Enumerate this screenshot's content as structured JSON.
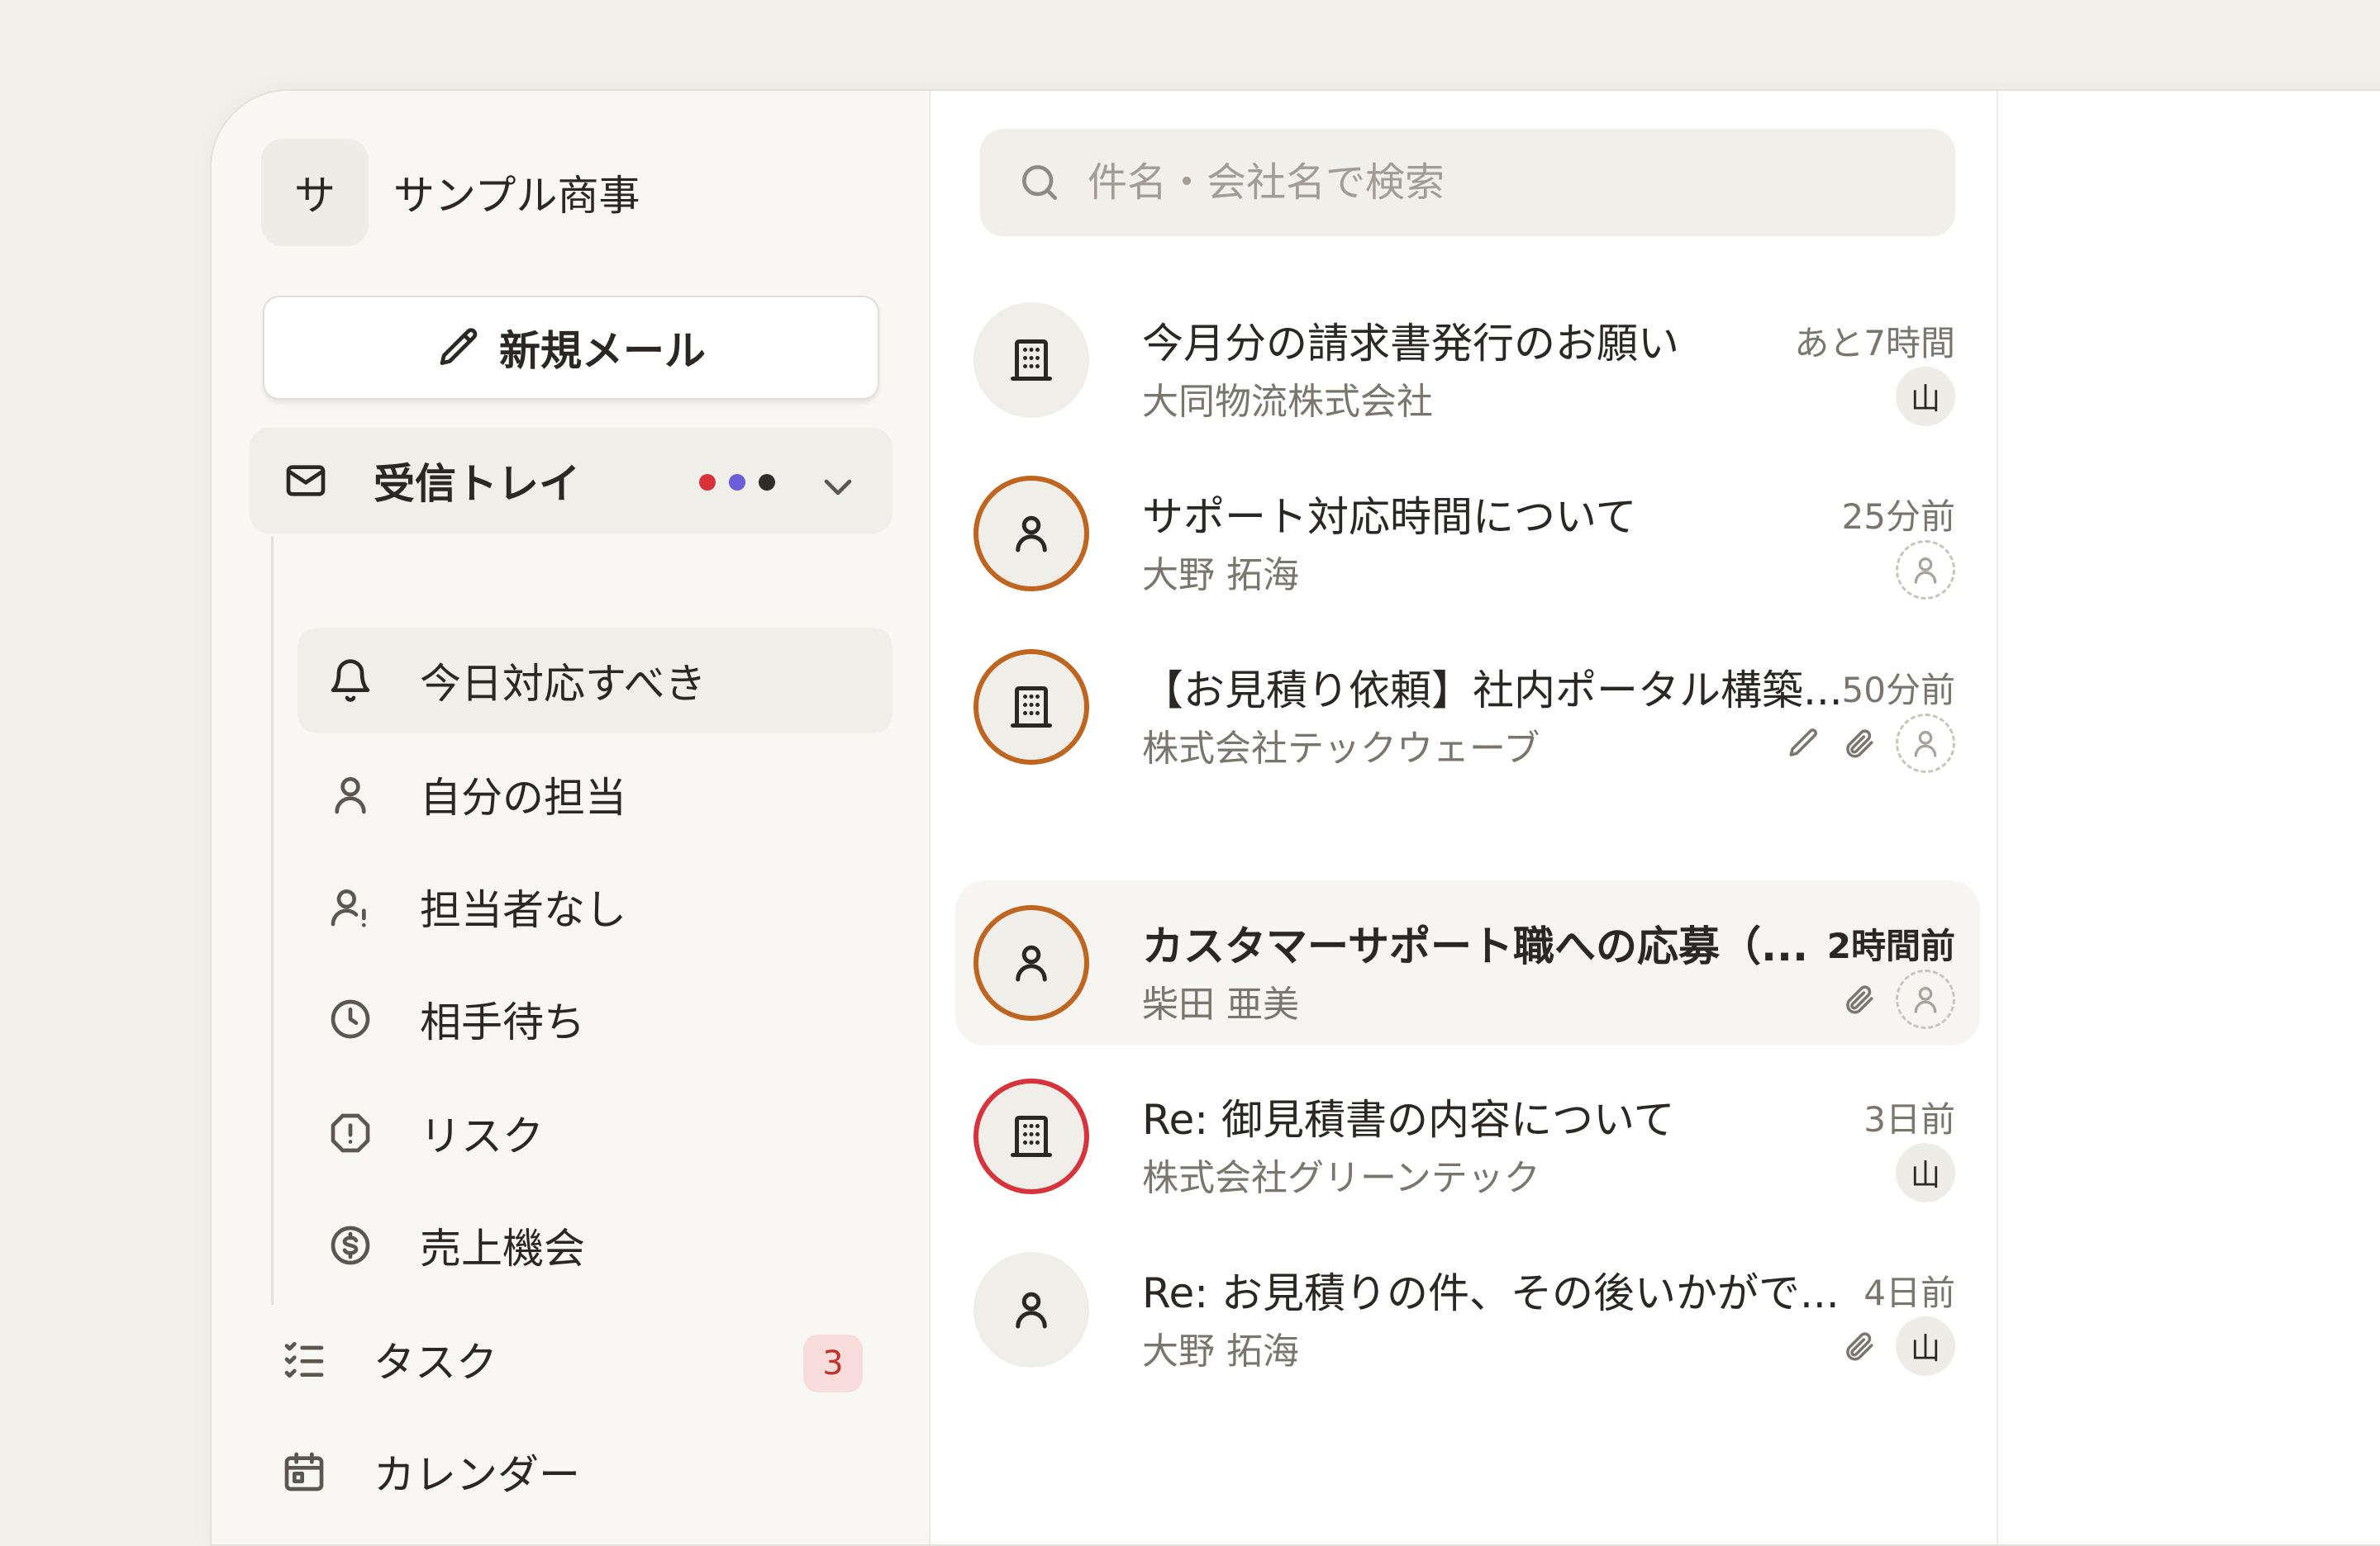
{
  "org": {
    "initial": "サ",
    "name": "サンプル商事"
  },
  "compose": {
    "label": "新規メール"
  },
  "nav": {
    "inbox": {
      "label": "受信トレイ",
      "status_dots": [
        "#d8333a",
        "#6a5fd8",
        "#2f2d2a"
      ]
    },
    "sub_items": [
      {
        "label": "今日対応すべき",
        "icon": "bell-icon"
      },
      {
        "label": "自分の担当",
        "icon": "user-icon"
      },
      {
        "label": "担当者なし",
        "icon": "user-alert-icon"
      },
      {
        "label": "相手待ち",
        "icon": "clock-icon"
      },
      {
        "label": "リスク",
        "icon": "alert-octagon-icon"
      },
      {
        "label": "売上機会",
        "icon": "dollar-circle-icon"
      }
    ],
    "tasks": {
      "label": "タスク",
      "badge": "3",
      "icon": "checklist-icon"
    },
    "calendar": {
      "label": "カレンダー",
      "icon": "calendar-icon"
    }
  },
  "search": {
    "placeholder": "件名・会社名で検索",
    "value": ""
  },
  "threads": [
    {
      "subject": "今月分の請求書発行のお願い",
      "sender": "大同物流株式会社",
      "time": "あと7時間",
      "assignee": "山",
      "avatar_icon": "building-icon"
    },
    {
      "subject": "サポート対応時間について",
      "sender": "大野 拓海",
      "time": "25分前",
      "assignee": "",
      "avatar_icon": "person-icon"
    },
    {
      "subject": "【お見積り依頼】社内ポータル構築...",
      "sender": "株式会社テックウェーブ",
      "time": "50分前",
      "assignee": "",
      "avatar_icon": "building-icon"
    },
    {
      "subject": "カスタマーサポート職への応募（...",
      "sender": "柴田 亜美",
      "time": "2時間前",
      "assignee": "",
      "avatar_icon": "person-icon"
    },
    {
      "subject": "Re: 御見積書の内容について",
      "sender": "株式会社グリーンテック",
      "time": "3日前",
      "assignee": "山",
      "avatar_icon": "building-icon"
    },
    {
      "subject": "Re: お見積りの件、その後いかがで...",
      "sender": "大野 拓海",
      "time": "4日前",
      "assignee": "山",
      "avatar_icon": "person-icon"
    }
  ],
  "colors": {
    "ring_orange": "#c0651f",
    "ring_red": "#d8333a",
    "badge_bg": "#f7dcd9",
    "badge_text": "#c0312b"
  }
}
